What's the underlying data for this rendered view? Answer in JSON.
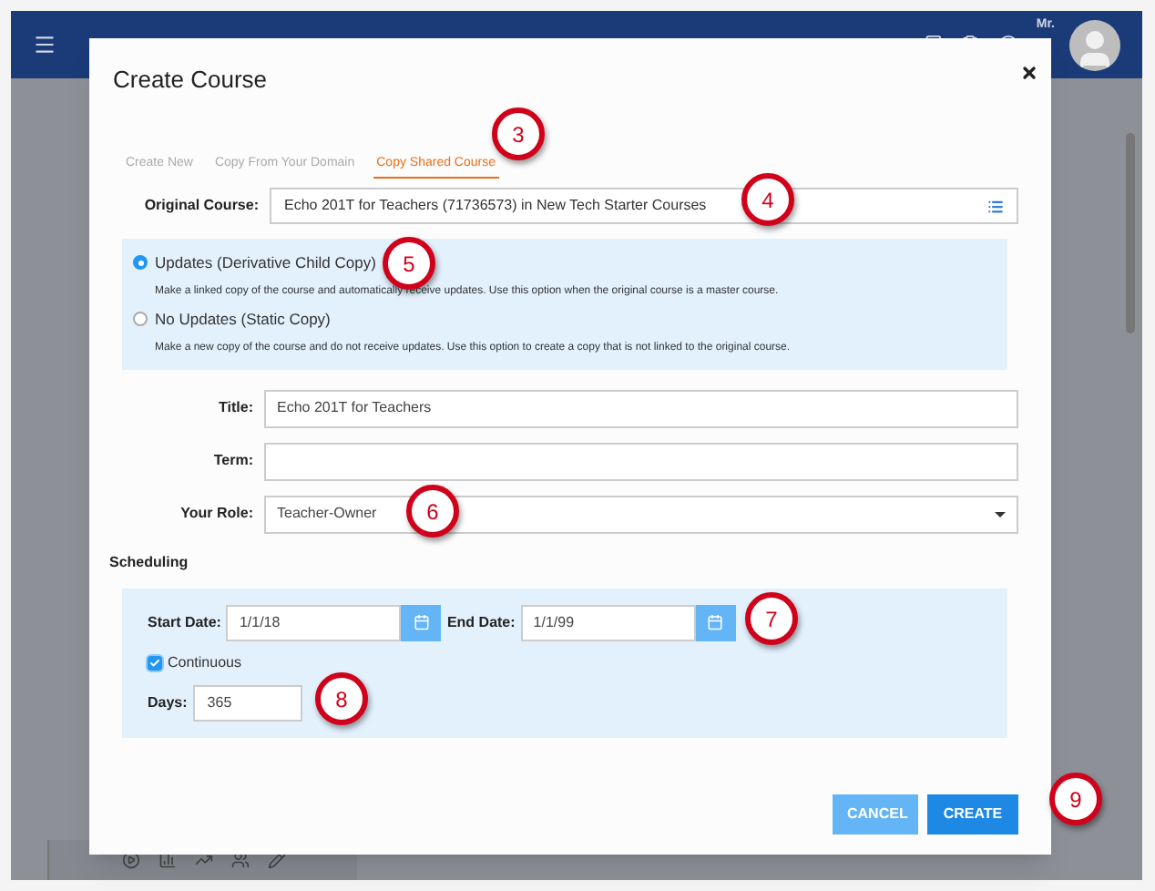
{
  "header": {
    "user": "Mr."
  },
  "dialog": {
    "title": "Create Course",
    "tabs": [
      {
        "label": "Create New",
        "selected": false
      },
      {
        "label": "Copy From Your Domain",
        "selected": false
      },
      {
        "label": "Copy Shared Course",
        "selected": true
      }
    ],
    "original_course": {
      "label": "Original Course:",
      "value": "Echo 201T for Teachers (71736573) in New Tech Starter Courses"
    },
    "copy_options": [
      {
        "label": "Updates (Derivative Child Copy)",
        "description": "Make a linked copy of the course and automatically receive updates. Use this option when the original course is a master course.",
        "selected": true
      },
      {
        "label": "No Updates (Static Copy)",
        "description": "Make a new copy of the course and do not receive updates. Use this option to create a copy that is not linked to the original course.",
        "selected": false
      }
    ],
    "fields": [
      {
        "label": "Title:",
        "value": "Echo 201T for Teachers",
        "kind": "text"
      },
      {
        "label": "Term:",
        "kind": "text"
      },
      {
        "label": "Your Role:",
        "value": "Teacher-Owner",
        "kind": "select"
      }
    ],
    "scheduling": {
      "heading": "Scheduling",
      "start_date": {
        "label": "Start Date:",
        "value": "1/1/18"
      },
      "end_date": {
        "label": "End Date:",
        "value": "1/1/99"
      },
      "continuous": {
        "label": "Continuous",
        "checked": true
      },
      "days": {
        "label": "Days:",
        "value": "365"
      }
    },
    "buttons": [
      {
        "label": "CANCEL",
        "kind": "secondary"
      },
      {
        "label": "CREATE",
        "kind": "primary"
      }
    ]
  },
  "callouts": [
    {
      "number": "3"
    },
    {
      "number": "4"
    },
    {
      "number": "5"
    },
    {
      "number": "6"
    },
    {
      "number": "7"
    },
    {
      "number": "8"
    },
    {
      "number": "9"
    }
  ]
}
